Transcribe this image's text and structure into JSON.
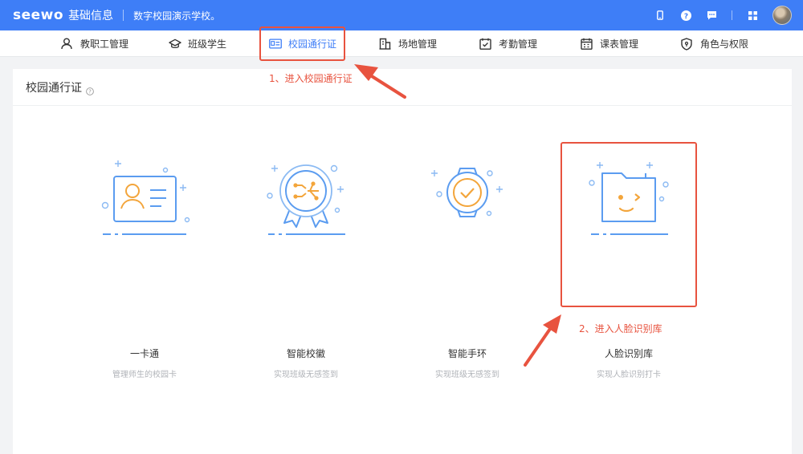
{
  "header": {
    "logo": "seewo",
    "app_name": "基础信息",
    "school": "数字校园演示学校。",
    "icons": [
      "phone-icon",
      "help-icon",
      "message-icon",
      "apps-grid-icon"
    ]
  },
  "nav": {
    "items": [
      {
        "label": "教职工管理",
        "icon": "person-icon"
      },
      {
        "label": "班级学生",
        "icon": "graduation-cap-icon"
      },
      {
        "label": "校园通行证",
        "icon": "id-card-icon",
        "active": true
      },
      {
        "label": "场地管理",
        "icon": "building-icon"
      },
      {
        "label": "考勤管理",
        "icon": "clipboard-check-icon"
      },
      {
        "label": "课表管理",
        "icon": "calendar-icon"
      },
      {
        "label": "角色与权限",
        "icon": "shield-icon"
      }
    ]
  },
  "page": {
    "title": "校园通行证"
  },
  "features": [
    {
      "title": "一卡通",
      "desc": "管理师生的校园卡",
      "icon": "id-card-illustration"
    },
    {
      "title": "智能校徽",
      "desc": "实现班级无感签到",
      "icon": "badge-illustration"
    },
    {
      "title": "智能手环",
      "desc": "实现班级无感签到",
      "icon": "smart-watch-illustration"
    },
    {
      "title": "人脸识别库",
      "desc": "实现人脸识别打卡",
      "icon": "face-folder-illustration"
    }
  ],
  "annotations": {
    "step1": "1、进入校园通行证",
    "step2": "2、进入人脸识别库"
  },
  "colors": {
    "brand_blue": "#3e7ef7",
    "annotation_red": "#e8533f",
    "illus_blue": "#5b9cf0",
    "illus_orange": "#f3a53b"
  }
}
